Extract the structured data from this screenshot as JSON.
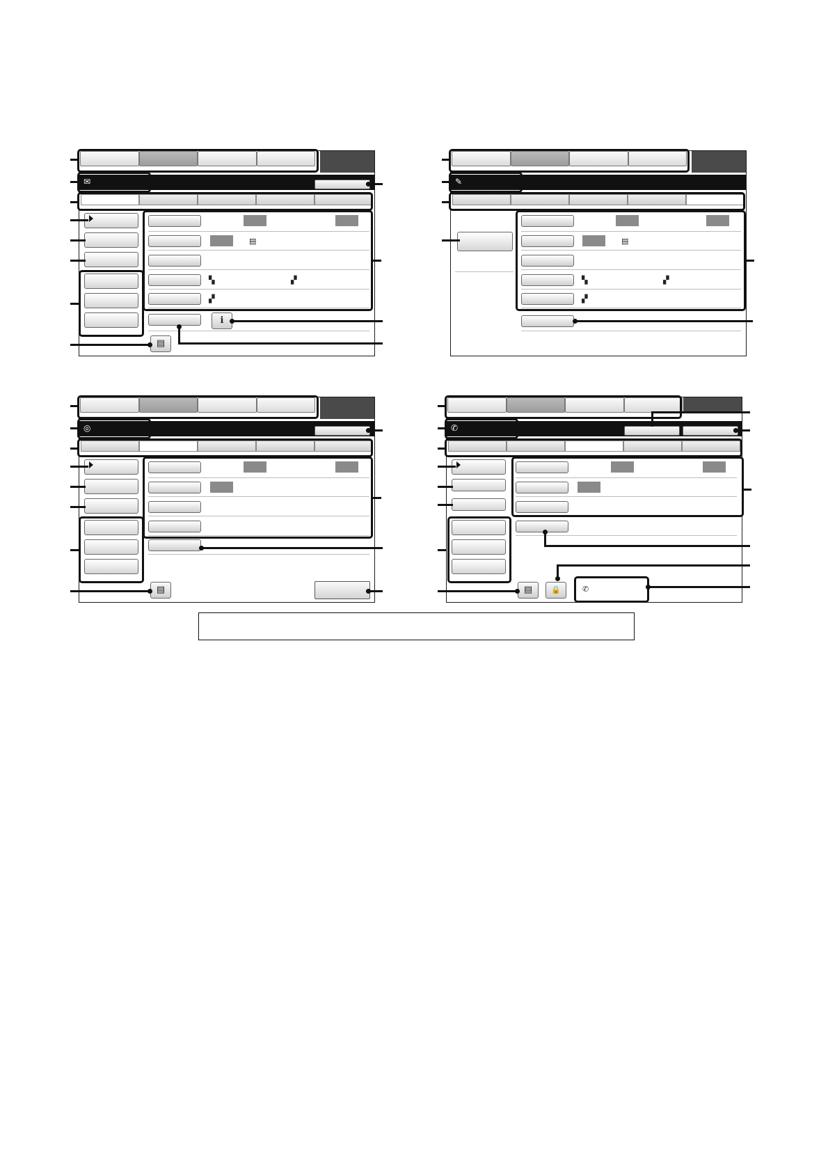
{
  "page": {
    "caption_box_text": ""
  },
  "screens": [
    {
      "id": "email",
      "mode_icon": "envelope-icon",
      "mode_glyph": "✉"
    },
    {
      "id": "data-entry",
      "mode_icon": "clip-icon",
      "mode_glyph": "✎"
    },
    {
      "id": "internet-fax",
      "mode_icon": "globe-icon",
      "mode_glyph": "◎"
    },
    {
      "id": "fax",
      "mode_icon": "phone-icon",
      "mode_glyph": "✆"
    }
  ],
  "icons": {
    "info": "ℹ",
    "address": "▤",
    "lock": "🔒",
    "fax_memory": "✆"
  }
}
